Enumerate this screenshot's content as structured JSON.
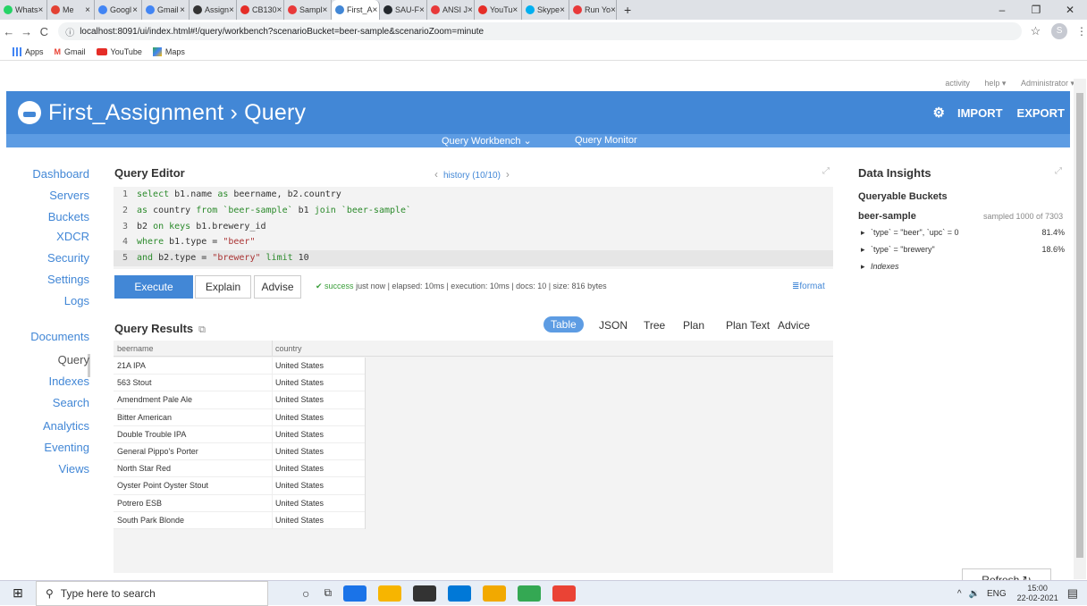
{
  "browser": {
    "tabs": [
      {
        "label": "Whats",
        "color": "#25d366"
      },
      {
        "label": "Me",
        "color": "#e34133"
      },
      {
        "label": "Googl",
        "color": "#4285f4"
      },
      {
        "label": "Gmail",
        "color": "#4285f4"
      },
      {
        "label": "Assign",
        "color": "#333333"
      },
      {
        "label": "CB130",
        "color": "#e52d27"
      },
      {
        "label": "Sampl",
        "color": "#e8393a"
      },
      {
        "label": "First_A",
        "color": "#4287d6"
      },
      {
        "label": "SAU-F",
        "color": "#24292e"
      },
      {
        "label": "ANSI J",
        "color": "#e8393a"
      },
      {
        "label": "YouTu",
        "color": "#e52d27"
      },
      {
        "label": "Skype",
        "color": "#00aff0"
      },
      {
        "label": "Run Yo",
        "color": "#e8393a"
      }
    ],
    "active_tab": 7,
    "close_glyph": "×",
    "new_tab": "+",
    "window_controls": [
      "–",
      "❐",
      "✕"
    ],
    "url": "localhost:8091/ui/index.html#!/query/workbench?scenarioBucket=beer-sample&scenarioZoom=minute",
    "profile_initial": "S",
    "bookmarks": [
      "Apps",
      "Gmail",
      "YouTube",
      "Maps"
    ]
  },
  "util": {
    "activity": "activity",
    "help": "help ▾",
    "user": "Administrator ▾"
  },
  "header": {
    "title": "First_Assignment › Query",
    "import": "IMPORT",
    "export": "EXPORT",
    "accent": "#4287d6"
  },
  "subnav": {
    "workbench": "Query Workbench  ⌄",
    "monitor": "Query Monitor"
  },
  "sidebar": {
    "items": [
      "Dashboard",
      "Servers",
      "Buckets",
      "XDCR",
      "Security",
      "Settings",
      "Logs",
      "Documents",
      "Query",
      "Indexes",
      "Search",
      "Analytics",
      "Eventing",
      "Views"
    ],
    "selected": "Query"
  },
  "editor": {
    "title": "Query Editor",
    "history": "history (10/10)",
    "lines": [
      {
        "n": "1",
        "parts": [
          [
            "kw",
            "select "
          ],
          [
            "nm",
            "b1.name "
          ],
          [
            "kw",
            "as "
          ],
          [
            "nm",
            "beername, b2.country"
          ]
        ]
      },
      {
        "n": "2",
        "parts": [
          [
            "kw",
            "as "
          ],
          [
            "nm",
            "country "
          ],
          [
            "kw",
            "from "
          ],
          [
            "bq",
            "`beer-sample` "
          ],
          [
            "nm",
            "b1 "
          ],
          [
            "kw",
            "join "
          ],
          [
            "bq",
            "`beer-sample`"
          ]
        ]
      },
      {
        "n": "3",
        "parts": [
          [
            "nm",
            "b2 "
          ],
          [
            "kw",
            "on keys "
          ],
          [
            "nm",
            "b1.brewery_id"
          ]
        ]
      },
      {
        "n": "4",
        "parts": [
          [
            "kw",
            "where "
          ],
          [
            "nm",
            "b1.type = "
          ],
          [
            "str",
            "\"beer\""
          ]
        ]
      },
      {
        "n": "5",
        "parts": [
          [
            "kw",
            "and "
          ],
          [
            "nm",
            "b2.type = "
          ],
          [
            "str",
            "\"brewery\" "
          ],
          [
            "kw",
            "limit "
          ],
          [
            "nm",
            "10"
          ]
        ]
      }
    ],
    "execute": "Execute",
    "explain": "Explain",
    "advise": "Advise",
    "status_ok": "✔ success",
    "status_rest": "just now | elapsed: 10ms | execution: 10ms | docs: 10 | size: 816 bytes",
    "format": "format"
  },
  "results": {
    "title": "Query Results",
    "tabs": [
      "Table",
      "JSON",
      "Tree",
      "Plan",
      "Plan Text",
      "Advice"
    ],
    "active_tab": "Table",
    "columns": [
      "beername",
      "country"
    ],
    "rows": [
      [
        "21A IPA",
        "United States"
      ],
      [
        "563 Stout",
        "United States"
      ],
      [
        "Amendment Pale Ale",
        "United States"
      ],
      [
        "Bitter American",
        "United States"
      ],
      [
        "Double Trouble IPA",
        "United States"
      ],
      [
        "General Pippo's Porter",
        "United States"
      ],
      [
        "North Star Red",
        "United States"
      ],
      [
        "Oyster Point Oyster Stout",
        "United States"
      ],
      [
        "Potrero ESB",
        "United States"
      ],
      [
        "South Park Blonde",
        "United States"
      ]
    ]
  },
  "insights": {
    "title": "Data Insights",
    "queryable": "Queryable Buckets",
    "bucket": "beer-sample",
    "sampled": "sampled 1000 of 7303",
    "items": [
      {
        "label": "`type` = \"beer\", `upc` = 0",
        "pct": "81.4%"
      },
      {
        "label": "`type` = \"brewery\"",
        "pct": "18.6%"
      },
      {
        "label": "Indexes",
        "pct": ""
      }
    ],
    "refresh": "Refresh"
  },
  "taskbar": {
    "search_placeholder": "Type here to search",
    "lang": "ENG",
    "time": "15:00",
    "date": "22-02-2021",
    "icons": [
      "#1a73e8",
      "#f7b500",
      "#333333",
      "#0078d7",
      "#f2a900",
      "#34a853",
      "#ea4335"
    ]
  }
}
